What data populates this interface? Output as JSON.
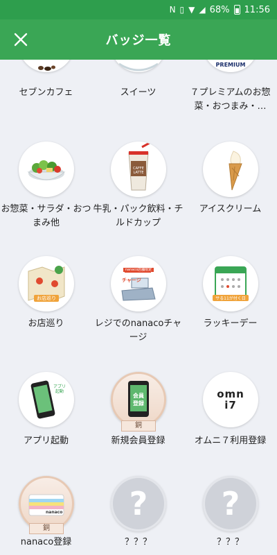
{
  "status": {
    "battery": "68%",
    "time": "11:56"
  },
  "header": {
    "title": "バッジ一覧"
  },
  "badges": [
    {
      "label": "セブンカフェ"
    },
    {
      "label": "スイーツ"
    },
    {
      "label": "７プレミアムのお惣菜・おつまみ・…",
      "logo_text": "PREMIUM"
    },
    {
      "label": "お惣菜・サラダ・おつまみ他"
    },
    {
      "label": "牛乳・パック飲料・チルドカップ",
      "logo_text": "CAFFE LATTE"
    },
    {
      "label": "アイスクリーム"
    },
    {
      "label": "お店巡り",
      "sub_text": "お店巡り"
    },
    {
      "label": "レジでのnanacoチャージ",
      "sub_text": "nanaco店舗限定",
      "sub_text2": "チャージ"
    },
    {
      "label": "ラッキーデー",
      "sub_text": "サる11が付く日"
    },
    {
      "label": "アプリ起動",
      "sub_text": "アプリ起動"
    },
    {
      "label": "新規会員登録",
      "sub_text": "会員登録",
      "rank": "銅"
    },
    {
      "label": "オムニ７利用登録",
      "logo_text": "omni7"
    },
    {
      "label": "nanaco登録",
      "sub_text": "nanaco",
      "rank": "銅"
    },
    {
      "label": "？？？"
    },
    {
      "label": "？？？"
    }
  ],
  "colors": {
    "accent": "#3aa655",
    "status_bar": "#2e9e4d",
    "background": "#eef0f5"
  }
}
